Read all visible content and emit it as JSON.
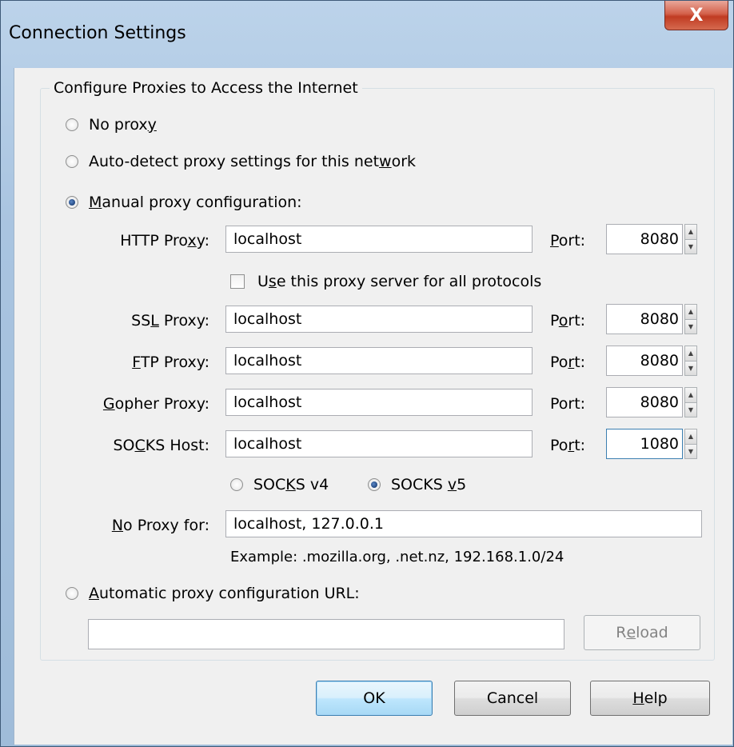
{
  "window": {
    "title": "Connection Settings",
    "close_glyph": "X"
  },
  "group": {
    "legend": "Configure Proxies to Access the Internet"
  },
  "options": {
    "no_proxy": {
      "pre": "No prox",
      "key": "y",
      "post": "",
      "checked": false
    },
    "auto_detect": {
      "pre": "Auto-detect proxy settings for this net",
      "key": "w",
      "post": "ork",
      "checked": false
    },
    "manual": {
      "pre": "",
      "key": "M",
      "post": "anual proxy configuration:",
      "checked": true
    },
    "auto_url": {
      "pre": "",
      "key": "A",
      "post": "utomatic proxy configuration URL:",
      "checked": false
    }
  },
  "http": {
    "label_pre": "HTTP Pro",
    "label_key": "x",
    "label_post": "y:",
    "value": "localhost",
    "port_pre": "",
    "port_key": "P",
    "port_post": "ort:",
    "port": "8080"
  },
  "use_all": {
    "pre": "U",
    "key": "s",
    "post": "e this proxy server for all protocols",
    "checked": false
  },
  "ssl": {
    "label_pre": "SS",
    "label_key": "L",
    "label_post": " Proxy:",
    "value": "localhost",
    "port_pre": "P",
    "port_key": "o",
    "port_post": "rt:",
    "port": "8080"
  },
  "ftp": {
    "label_pre": "",
    "label_key": "F",
    "label_post": "TP Proxy:",
    "value": "localhost",
    "port_pre": "Po",
    "port_key": "r",
    "port_post": "t:",
    "port": "8080"
  },
  "gopher": {
    "label_pre": "",
    "label_key": "G",
    "label_post": "opher Proxy:",
    "value": "localhost",
    "port_pre": "",
    "port_key": "",
    "port_post": "Port:",
    "port": "8080"
  },
  "socks": {
    "label_pre": "SO",
    "label_key": "C",
    "label_post": "KS Host:",
    "value": "localhost",
    "port_pre": "Po",
    "port_key": "r",
    "port_post": "t:",
    "port": "1080"
  },
  "socks_version": {
    "v4": {
      "pre": "SOC",
      "key": "K",
      "post": "S v4",
      "checked": false
    },
    "v5": {
      "pre": "SOCKS ",
      "key": "v",
      "post": "5",
      "checked": true
    }
  },
  "no_proxy_for": {
    "label_pre": "",
    "label_key": "N",
    "label_post": "o Proxy for:",
    "value": "localhost, 127.0.0.1",
    "example": "Example: .mozilla.org, .net.nz, 192.168.1.0/24"
  },
  "auto_url": {
    "value": ""
  },
  "buttons": {
    "reload": {
      "pre": "R",
      "key": "e",
      "post": "load"
    },
    "ok": "OK",
    "cancel": "Cancel",
    "help": {
      "pre": "",
      "key": "H",
      "post": "elp"
    }
  },
  "spinner": {
    "up": "▲",
    "down": "▼"
  }
}
